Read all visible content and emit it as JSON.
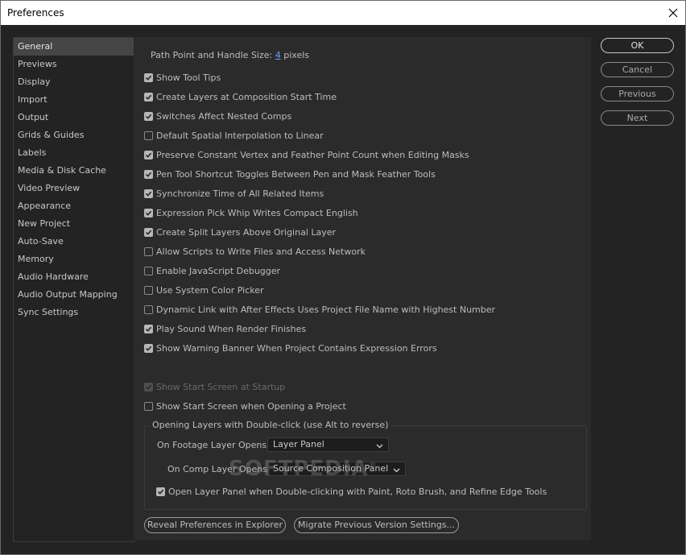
{
  "window": {
    "title": "Preferences"
  },
  "sidebar": {
    "selected": "General",
    "items": [
      {
        "label": "General"
      },
      {
        "label": "Previews"
      },
      {
        "label": "Display"
      },
      {
        "label": "Import"
      },
      {
        "label": "Output"
      },
      {
        "label": "Grids & Guides"
      },
      {
        "label": "Labels"
      },
      {
        "label": "Media & Disk Cache"
      },
      {
        "label": "Video Preview"
      },
      {
        "label": "Appearance"
      },
      {
        "label": "New Project"
      },
      {
        "label": "Auto-Save"
      },
      {
        "label": "Memory"
      },
      {
        "label": "Audio Hardware"
      },
      {
        "label": "Audio Output Mapping"
      },
      {
        "label": "Sync Settings"
      }
    ]
  },
  "general": {
    "path_point_label": "Path Point and Handle Size:",
    "path_point_value": "4",
    "path_point_unit": "pixels",
    "options": [
      {
        "label": "Show Tool Tips",
        "checked": true
      },
      {
        "label": "Create Layers at Composition Start Time",
        "checked": true
      },
      {
        "label": "Switches Affect Nested Comps",
        "checked": true
      },
      {
        "label": "Default Spatial Interpolation to Linear",
        "checked": false
      },
      {
        "label": "Preserve Constant Vertex and Feather Point Count when Editing Masks",
        "checked": true
      },
      {
        "label": "Pen Tool Shortcut Toggles Between Pen and Mask Feather Tools",
        "checked": true
      },
      {
        "label": "Synchronize Time of All Related Items",
        "checked": true
      },
      {
        "label": "Expression Pick Whip Writes Compact English",
        "checked": true
      },
      {
        "label": "Create Split Layers Above Original Layer",
        "checked": true
      },
      {
        "label": "Allow Scripts to Write Files and Access Network",
        "checked": false
      },
      {
        "label": "Enable JavaScript Debugger",
        "checked": false
      },
      {
        "label": "Use System Color Picker",
        "checked": false
      },
      {
        "label": "Dynamic Link with After Effects Uses Project File Name with Highest Number",
        "checked": false
      },
      {
        "label": "Play Sound When Render Finishes",
        "checked": true
      },
      {
        "label": "Show Warning Banner When Project Contains Expression Errors",
        "checked": true
      }
    ],
    "start_screen_options": [
      {
        "label": "Show Start Screen at Startup",
        "checked": true,
        "disabled": true
      },
      {
        "label": "Show Start Screen when Opening a Project",
        "checked": false,
        "disabled": false
      }
    ],
    "double_click_group": {
      "title": "Opening Layers with Double-click (use Alt to reverse)",
      "footage_label": "On Footage Layer Opens:",
      "footage_value": "Layer Panel",
      "comp_label": "On Comp Layer Opens:",
      "comp_value": "Source Composition Panel",
      "paint_option": {
        "label": "Open Layer Panel when Double-clicking with Paint, Roto Brush, and Refine Edge Tools",
        "checked": true
      }
    },
    "reveal_button": "Reveal Preferences in Explorer",
    "migrate_button": "Migrate Previous Version Settings..."
  },
  "buttons": {
    "ok": "OK",
    "cancel": "Cancel",
    "previous": "Previous",
    "next": "Next"
  },
  "watermark": "SOFTPEDIA",
  "watermark_mark": "®",
  "colors": {
    "background": "#232323",
    "panel": "#2b2b2b",
    "link": "#6aa0ff",
    "selected_item": "#454545"
  },
  "icons": {
    "close": "close-icon",
    "check": "check-icon",
    "dropdown": "chevron-down-icon"
  }
}
